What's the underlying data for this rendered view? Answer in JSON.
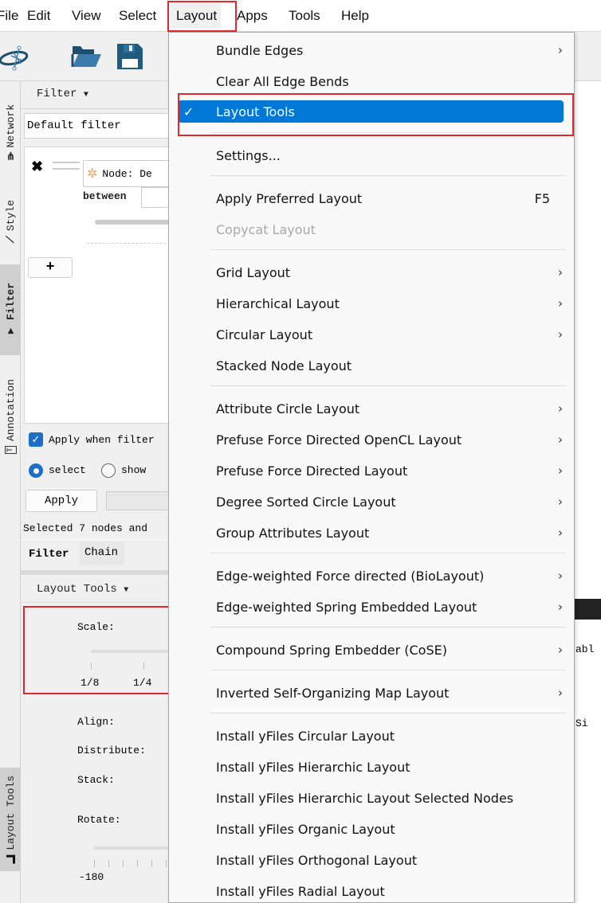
{
  "menubar": {
    "items": [
      "File",
      "Edit",
      "View",
      "Select",
      "Layout",
      "Apps",
      "Tools",
      "Help"
    ],
    "active": "Layout"
  },
  "toolbar": {
    "icons": [
      "cytoscape-logo-icon",
      "open-folder-icon",
      "save-icon"
    ]
  },
  "side_tabs": [
    {
      "label": "Network",
      "icon": "network-icon"
    },
    {
      "label": "Style",
      "icon": "style-icon"
    },
    {
      "label": "Filter",
      "icon": "filter-icon",
      "selected": true
    },
    {
      "label": "Annotation",
      "icon": "annotation-icon"
    },
    {
      "label": "Layout Tools",
      "icon": "layout-tools-icon"
    }
  ],
  "filter_panel": {
    "header": "Filter",
    "filter_name": "Default filter",
    "node_filter_label": "Node: De",
    "between_label": "between",
    "add_button": "+",
    "apply_when_filter_label": "Apply when filter",
    "apply_when_filter_checked": true,
    "radio_select": "select",
    "radio_show": "show",
    "radio_selected": "select",
    "apply_button": "Apply",
    "status": "Selected 7 nodes and",
    "tabs": [
      "Filter",
      "Chain"
    ],
    "active_tab": "Filter"
  },
  "layout_tools_panel": {
    "header": "Layout Tools",
    "scale_label": "Scale:",
    "scale_ticks": [
      "1/8",
      "1/4"
    ],
    "align_label": "Align:",
    "distribute_label": "Distribute:",
    "stack_label": "Stack:",
    "rotate_label": "Rotate:",
    "rotate_tick": "-180"
  },
  "canvas_strip": {
    "partial_text_1": "abl",
    "partial_text_2": "Si"
  },
  "layout_menu": {
    "items": [
      {
        "label": "Bundle Edges",
        "submenu": true
      },
      {
        "label": "Clear All Edge Bends"
      },
      {
        "label": "Layout Tools",
        "checked": true,
        "highlighted": true
      },
      {
        "label": "Settings..."
      },
      {
        "label": "Apply Preferred Layout",
        "shortcut": "F5"
      },
      {
        "label": "Copycat Layout",
        "disabled": true
      },
      {
        "label": "Grid Layout",
        "submenu": true
      },
      {
        "label": "Hierarchical Layout",
        "submenu": true
      },
      {
        "label": "Circular Layout",
        "submenu": true
      },
      {
        "label": "Stacked Node Layout"
      },
      {
        "label": "Attribute Circle Layout",
        "submenu": true
      },
      {
        "label": "Prefuse Force Directed OpenCL Layout",
        "submenu": true
      },
      {
        "label": "Prefuse Force Directed Layout",
        "submenu": true
      },
      {
        "label": "Degree Sorted Circle Layout",
        "submenu": true
      },
      {
        "label": "Group Attributes Layout",
        "submenu": true
      },
      {
        "label": "Edge-weighted Force directed (BioLayout)",
        "submenu": true
      },
      {
        "label": "Edge-weighted Spring Embedded Layout",
        "submenu": true
      },
      {
        "label": "Compound Spring Embedder (CoSE)",
        "submenu": true
      },
      {
        "label": "Inverted Self-Organizing Map Layout",
        "submenu": true
      },
      {
        "label": "Install yFiles Circular Layout"
      },
      {
        "label": "Install yFiles Hierarchic Layout"
      },
      {
        "label": "Install yFiles Hierarchic Layout Selected Nodes"
      },
      {
        "label": "Install yFiles Organic Layout"
      },
      {
        "label": "Install yFiles Orthogonal Layout"
      },
      {
        "label": "Install yFiles Radial Layout"
      }
    ],
    "submenu_arrow": "›",
    "check_glyph": "✓"
  },
  "colors": {
    "highlight": "#0078d7",
    "annotation_red": "#e3262b",
    "icon_blue": "#1f5a7f"
  }
}
